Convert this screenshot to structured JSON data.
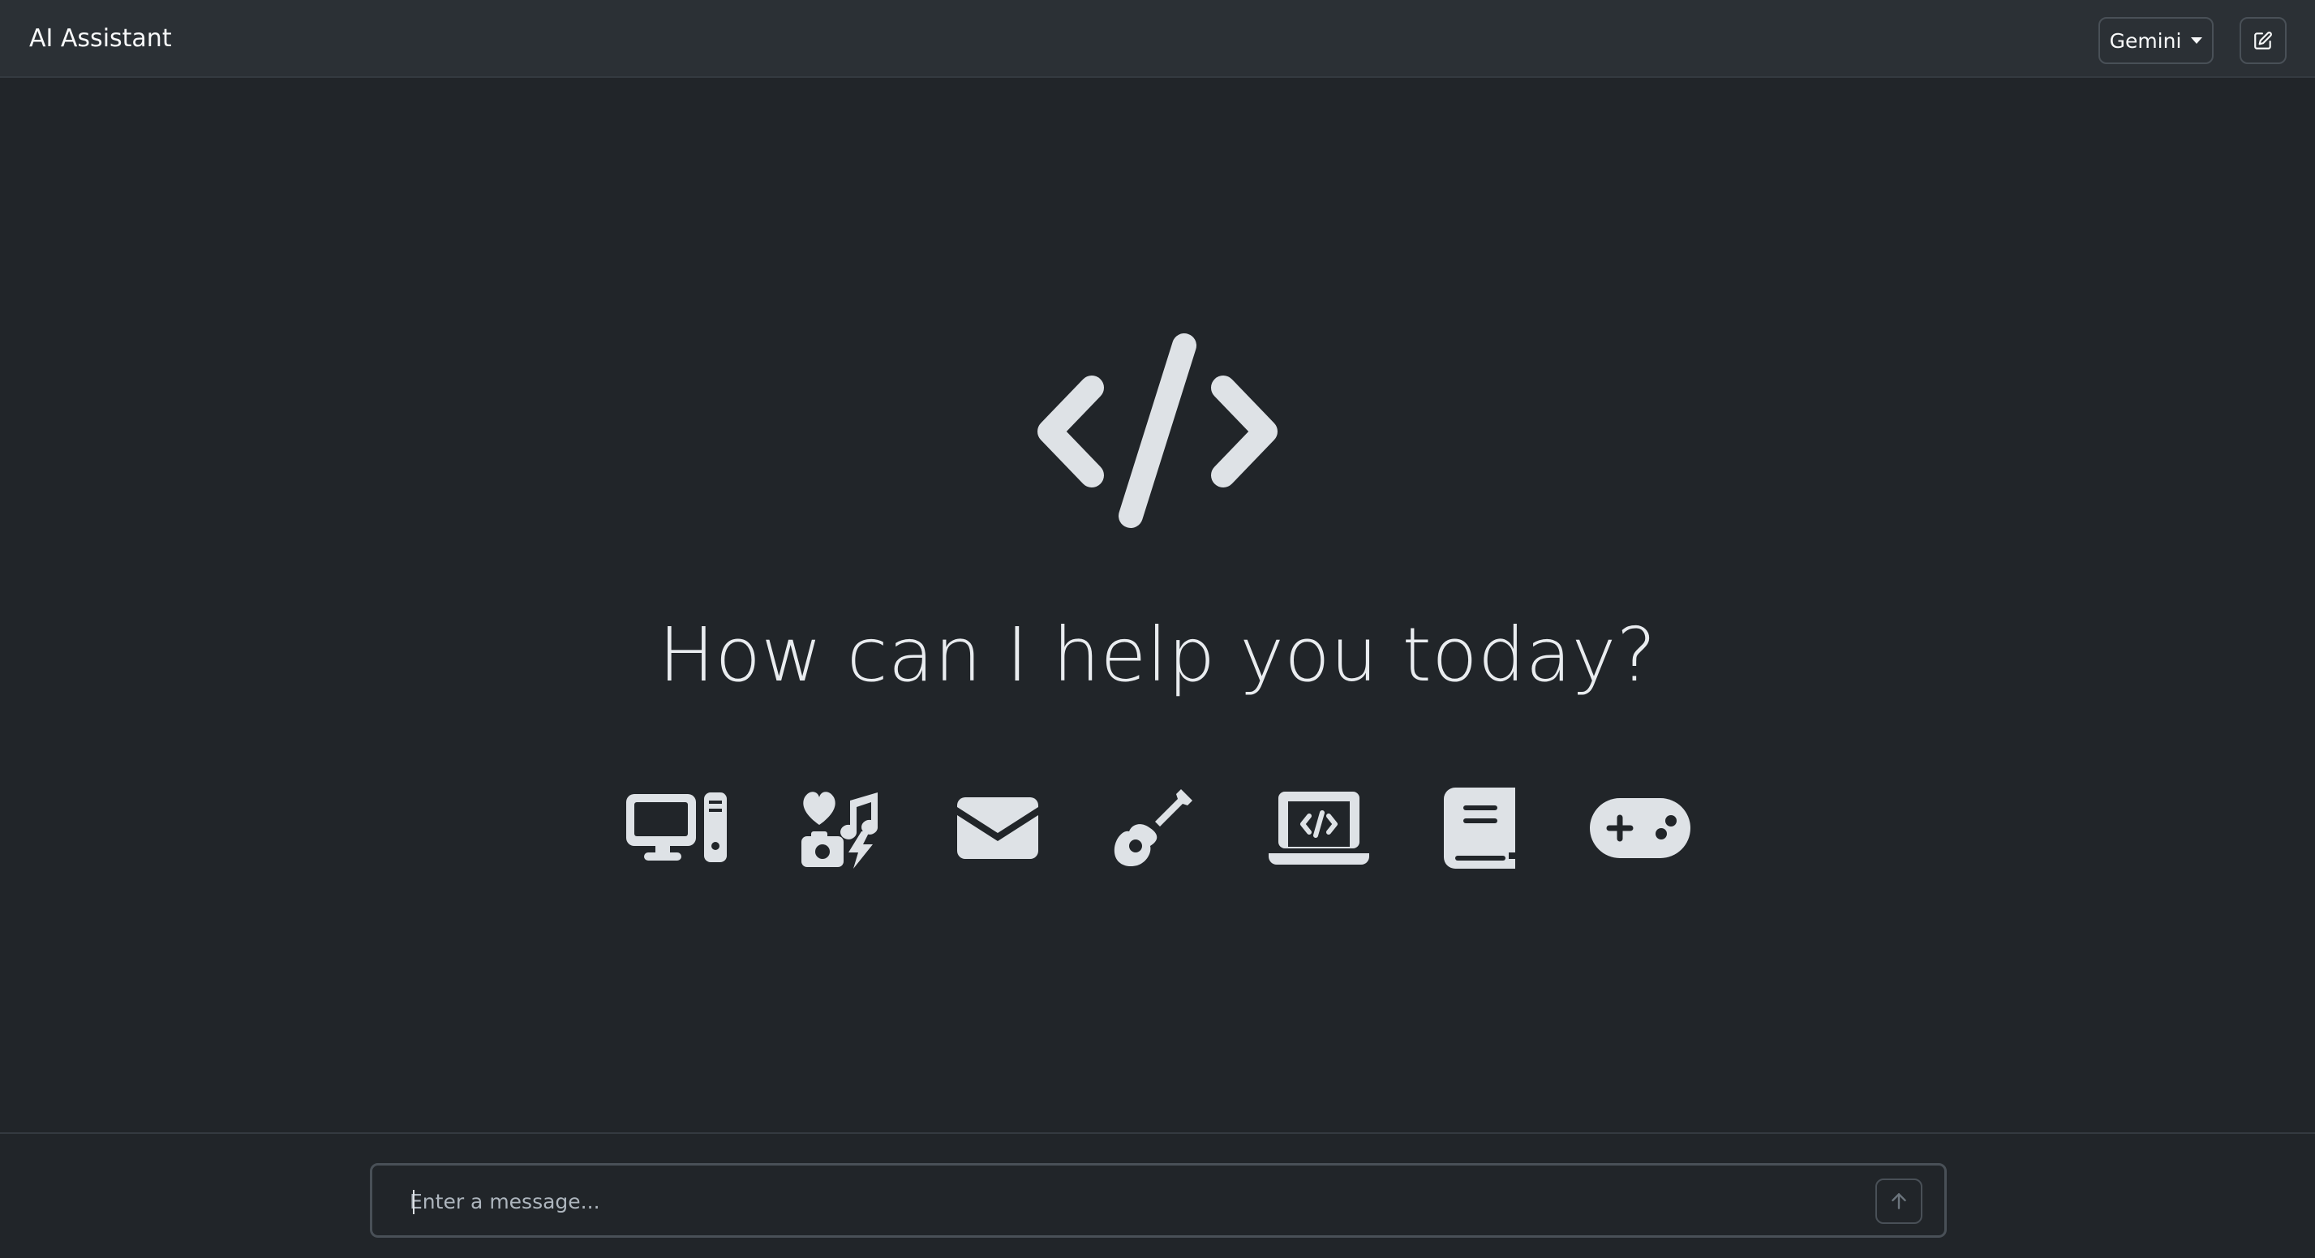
{
  "header": {
    "title": "AI Assistant",
    "model_selector": {
      "selected": "Gemini",
      "icon": "chevron-down-icon"
    },
    "new_chat": {
      "icon": "edit-icon"
    }
  },
  "hero": {
    "icon": "code-icon",
    "headline": "How can I help you today?"
  },
  "suggestions": [
    {
      "icon": "desktop-computer-icon"
    },
    {
      "icon": "hobbies-icon"
    },
    {
      "icon": "envelope-icon"
    },
    {
      "icon": "guitar-icon"
    },
    {
      "icon": "laptop-code-icon"
    },
    {
      "icon": "book-icon"
    },
    {
      "icon": "gamepad-icon"
    }
  ],
  "composer": {
    "placeholder": "Enter a message...",
    "value": "",
    "send_icon": "arrow-up-icon"
  },
  "colors": {
    "background": "#212529",
    "header_background": "#2b3035",
    "border": "#495057",
    "icon": "#dee2e6",
    "text": "#f8f9fa"
  }
}
